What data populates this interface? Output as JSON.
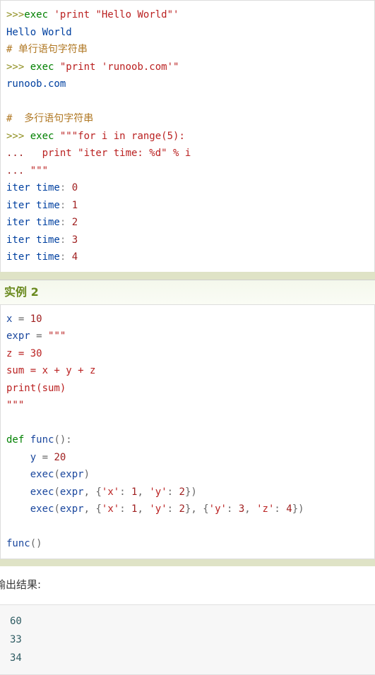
{
  "example1": {
    "lines": [
      {
        "segments": [
          {
            "t": ">>>",
            "c": "tok-prompt"
          },
          {
            "t": "exec",
            "c": "tok-kw"
          },
          {
            "t": " ",
            "c": "tok-plain"
          },
          {
            "t": "'print \"Hello World\"'",
            "c": "tok-str"
          }
        ]
      },
      {
        "segments": [
          {
            "t": "Hello World",
            "c": "tok-out"
          }
        ]
      },
      {
        "segments": [
          {
            "t": "# 单行语句字符串",
            "c": "tok-com"
          }
        ]
      },
      {
        "segments": [
          {
            "t": ">>> ",
            "c": "tok-prompt"
          },
          {
            "t": "exec",
            "c": "tok-kw"
          },
          {
            "t": " ",
            "c": "tok-plain"
          },
          {
            "t": "\"print 'runoob.com'\"",
            "c": "tok-str"
          }
        ]
      },
      {
        "segments": [
          {
            "t": "runoob.com",
            "c": "tok-out"
          }
        ]
      },
      {
        "segments": [
          {
            "t": "",
            "c": "tok-plain"
          }
        ]
      },
      {
        "segments": [
          {
            "t": "#  多行语句字符串",
            "c": "tok-com"
          }
        ]
      },
      {
        "segments": [
          {
            "t": ">>> ",
            "c": "tok-prompt"
          },
          {
            "t": "exec",
            "c": "tok-kw"
          },
          {
            "t": " ",
            "c": "tok-plain"
          },
          {
            "t": "\"\"\"for i in range(5):",
            "c": "tok-str"
          }
        ]
      },
      {
        "segments": [
          {
            "t": "... ",
            "c": "tok-prompt2"
          },
          {
            "t": "  print \"iter time: %d\" % i",
            "c": "tok-str"
          }
        ]
      },
      {
        "segments": [
          {
            "t": "... ",
            "c": "tok-prompt2"
          },
          {
            "t": "\"\"\"",
            "c": "tok-str"
          }
        ]
      },
      {
        "segments": [
          {
            "t": "iter time",
            "c": "tok-out"
          },
          {
            "t": ": ",
            "c": "tok-punct"
          },
          {
            "t": "0",
            "c": "tok-num"
          }
        ]
      },
      {
        "segments": [
          {
            "t": "iter time",
            "c": "tok-out"
          },
          {
            "t": ": ",
            "c": "tok-punct"
          },
          {
            "t": "1",
            "c": "tok-num"
          }
        ]
      },
      {
        "segments": [
          {
            "t": "iter time",
            "c": "tok-out"
          },
          {
            "t": ": ",
            "c": "tok-punct"
          },
          {
            "t": "2",
            "c": "tok-num"
          }
        ]
      },
      {
        "segments": [
          {
            "t": "iter time",
            "c": "tok-out"
          },
          {
            "t": ": ",
            "c": "tok-punct"
          },
          {
            "t": "3",
            "c": "tok-num"
          }
        ]
      },
      {
        "segments": [
          {
            "t": "iter time",
            "c": "tok-out"
          },
          {
            "t": ": ",
            "c": "tok-punct"
          },
          {
            "t": "4",
            "c": "tok-num"
          }
        ]
      }
    ]
  },
  "example2": {
    "title": "实例 2",
    "lines": [
      {
        "segments": [
          {
            "t": "x ",
            "c": "tok-name"
          },
          {
            "t": "= ",
            "c": "tok-op"
          },
          {
            "t": "10",
            "c": "tok-num"
          }
        ]
      },
      {
        "segments": [
          {
            "t": "expr ",
            "c": "tok-name"
          },
          {
            "t": "= ",
            "c": "tok-op"
          },
          {
            "t": "\"\"\"",
            "c": "tok-str"
          }
        ]
      },
      {
        "segments": [
          {
            "t": "z = 30",
            "c": "tok-str"
          }
        ]
      },
      {
        "segments": [
          {
            "t": "sum = x + y + z",
            "c": "tok-str"
          }
        ]
      },
      {
        "segments": [
          {
            "t": "print(sum)",
            "c": "tok-str"
          }
        ]
      },
      {
        "segments": [
          {
            "t": "\"\"\"",
            "c": "tok-str"
          }
        ]
      },
      {
        "segments": [
          {
            "t": "",
            "c": "tok-plain"
          }
        ]
      },
      {
        "segments": [
          {
            "t": "def ",
            "c": "tok-def"
          },
          {
            "t": "func",
            "c": "tok-fn"
          },
          {
            "t": "():",
            "c": "tok-op"
          }
        ]
      },
      {
        "segments": [
          {
            "t": "    y ",
            "c": "tok-name"
          },
          {
            "t": "= ",
            "c": "tok-op"
          },
          {
            "t": "20",
            "c": "tok-num"
          }
        ]
      },
      {
        "segments": [
          {
            "t": "    ",
            "c": "tok-plain"
          },
          {
            "t": "exec",
            "c": "tok-fn"
          },
          {
            "t": "(",
            "c": "tok-op"
          },
          {
            "t": "expr",
            "c": "tok-fn"
          },
          {
            "t": ")",
            "c": "tok-op"
          }
        ]
      },
      {
        "segments": [
          {
            "t": "    ",
            "c": "tok-plain"
          },
          {
            "t": "exec",
            "c": "tok-fn"
          },
          {
            "t": "(",
            "c": "tok-op"
          },
          {
            "t": "expr",
            "c": "tok-fn"
          },
          {
            "t": ", {",
            "c": "tok-op"
          },
          {
            "t": "'x'",
            "c": "tok-str"
          },
          {
            "t": ": ",
            "c": "tok-op"
          },
          {
            "t": "1",
            "c": "tok-num"
          },
          {
            "t": ", ",
            "c": "tok-op"
          },
          {
            "t": "'y'",
            "c": "tok-str"
          },
          {
            "t": ": ",
            "c": "tok-op"
          },
          {
            "t": "2",
            "c": "tok-num"
          },
          {
            "t": "})",
            "c": "tok-op"
          }
        ]
      },
      {
        "segments": [
          {
            "t": "    ",
            "c": "tok-plain"
          },
          {
            "t": "exec",
            "c": "tok-fn"
          },
          {
            "t": "(",
            "c": "tok-op"
          },
          {
            "t": "expr",
            "c": "tok-fn"
          },
          {
            "t": ", {",
            "c": "tok-op"
          },
          {
            "t": "'x'",
            "c": "tok-str"
          },
          {
            "t": ": ",
            "c": "tok-op"
          },
          {
            "t": "1",
            "c": "tok-num"
          },
          {
            "t": ", ",
            "c": "tok-op"
          },
          {
            "t": "'y'",
            "c": "tok-str"
          },
          {
            "t": ": ",
            "c": "tok-op"
          },
          {
            "t": "2",
            "c": "tok-num"
          },
          {
            "t": "}, {",
            "c": "tok-op"
          },
          {
            "t": "'y'",
            "c": "tok-str"
          },
          {
            "t": ": ",
            "c": "tok-op"
          },
          {
            "t": "3",
            "c": "tok-num"
          },
          {
            "t": ", ",
            "c": "tok-op"
          },
          {
            "t": "'z'",
            "c": "tok-str"
          },
          {
            "t": ": ",
            "c": "tok-op"
          },
          {
            "t": "4",
            "c": "tok-num"
          },
          {
            "t": "})",
            "c": "tok-op"
          }
        ]
      },
      {
        "segments": [
          {
            "t": "",
            "c": "tok-plain"
          }
        ]
      },
      {
        "segments": [
          {
            "t": "func",
            "c": "tok-fn"
          },
          {
            "t": "()",
            "c": "tok-op"
          }
        ]
      }
    ]
  },
  "output": {
    "intro": "输出结果:",
    "lines": [
      "60",
      "33",
      "34"
    ]
  },
  "colors": {
    "band": "#dfe3c6",
    "title": "#6a8a1f",
    "string": "#ba2121",
    "keyword": "#008000",
    "comment": "#b07824",
    "prompt": "#8f8f20",
    "prompt_cont": "#a02020",
    "output_text": "#0040a0",
    "result_text": "#2f5c63",
    "result_bg": "#f7f7f7"
  }
}
